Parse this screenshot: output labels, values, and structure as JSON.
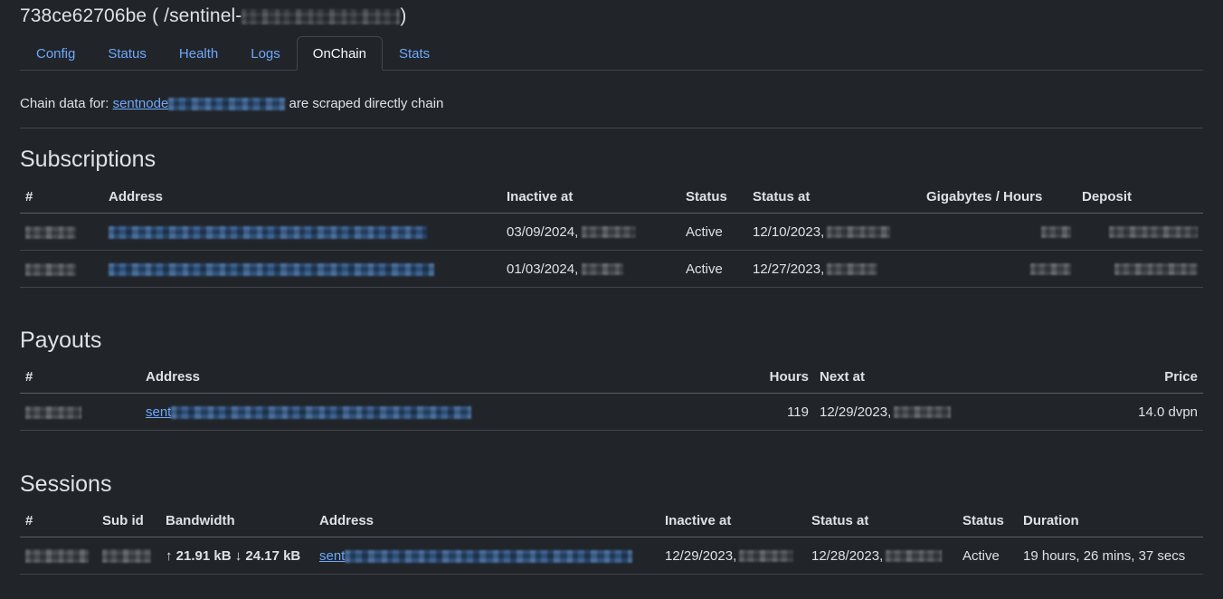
{
  "header": {
    "container_id": "738ce62706be",
    "path_prefix": "( /sentinel-",
    "path_suffix": ")",
    "path_redacted_width": 175
  },
  "tabs": [
    {
      "label": "Config",
      "active": false
    },
    {
      "label": "Status",
      "active": false
    },
    {
      "label": "Health",
      "active": false
    },
    {
      "label": "Logs",
      "active": false
    },
    {
      "label": "OnChain",
      "active": true
    },
    {
      "label": "Stats",
      "active": false
    }
  ],
  "chain_notice": {
    "prefix": "Chain data for:",
    "link_text": "sentnode",
    "link_redacted_width": 129,
    "suffix": "are scraped directly chain"
  },
  "sections": {
    "subscriptions": {
      "title": "Subscriptions",
      "columns": [
        "#",
        "Address",
        "Inactive at",
        "Status",
        "Status at",
        "Gigabytes / Hours",
        "Deposit"
      ],
      "rows": [
        {
          "id_redacted_width": 56,
          "address_redacted_width": 352,
          "inactive_at_date": "03/09/2024,",
          "inactive_at_redacted_width": 60,
          "status": "Active",
          "status_at_date": "12/10/2023,",
          "status_at_redacted_width": 70,
          "gigabytes_hours_redacted_width": 33,
          "deposit_redacted_width": 98
        },
        {
          "id_redacted_width": 56,
          "address_redacted_width": 360,
          "inactive_at_date": "01/03/2024,",
          "inactive_at_redacted_width": 46,
          "status": "Active",
          "status_at_date": "12/27/2023,",
          "status_at_redacted_width": 56,
          "gigabytes_hours_redacted_width": 45,
          "deposit_redacted_width": 92
        }
      ]
    },
    "payouts": {
      "title": "Payouts",
      "columns": [
        "#",
        "Address",
        "Hours",
        "Next at",
        "Price"
      ],
      "rows": [
        {
          "id_redacted_width": 62,
          "address_link_text": "sent",
          "address_redacted_width": 332,
          "hours": "119",
          "next_at_date": "12/29/2023,",
          "next_at_redacted_width": 63,
          "price": "14.0 dvpn"
        }
      ]
    },
    "sessions": {
      "title": "Sessions",
      "columns": [
        "#",
        "Sub id",
        "Bandwidth",
        "Address",
        "Inactive at",
        "Status at",
        "Status",
        "Duration"
      ],
      "rows": [
        {
          "id_redacted_width": 70,
          "sub_id_redacted_width": 54,
          "bandwidth": "↑ 21.91 kB ↓ 24.17 kB",
          "address_link_text": "sent",
          "address_redacted_width": 318,
          "inactive_at_date": "12/29/2023,",
          "inactive_at_redacted_width": 60,
          "status_at_date": "12/28/2023,",
          "status_at_redacted_width": 62,
          "status": "Active",
          "duration": "19 hours, 26 mins, 37 secs"
        }
      ]
    }
  },
  "colors": {
    "background": "#212529",
    "text": "#dee2e6",
    "link": "#6ea8fe",
    "border": "#41464b",
    "header_border": "#5b6065"
  }
}
